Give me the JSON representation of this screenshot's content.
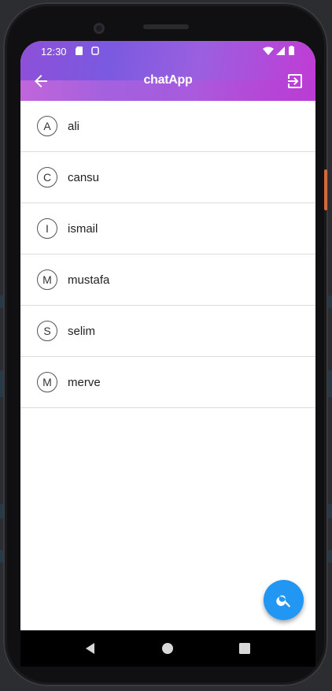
{
  "status_bar": {
    "time": "12:30"
  },
  "app_bar": {
    "title": "chatApp"
  },
  "contacts": [
    {
      "initial": "A",
      "name": "ali"
    },
    {
      "initial": "C",
      "name": "cansu"
    },
    {
      "initial": "I",
      "name": "ismail"
    },
    {
      "initial": "M",
      "name": "mustafa"
    },
    {
      "initial": "S",
      "name": "selim"
    },
    {
      "initial": "M",
      "name": "merve"
    }
  ],
  "colors": {
    "fab": "#2196f3",
    "appbar_start": "#8e4fd8",
    "appbar_end": "#c23bd4"
  },
  "icons": {
    "back": "arrow-back-icon",
    "logout": "exit-to-app-icon",
    "fab": "search-icon"
  }
}
